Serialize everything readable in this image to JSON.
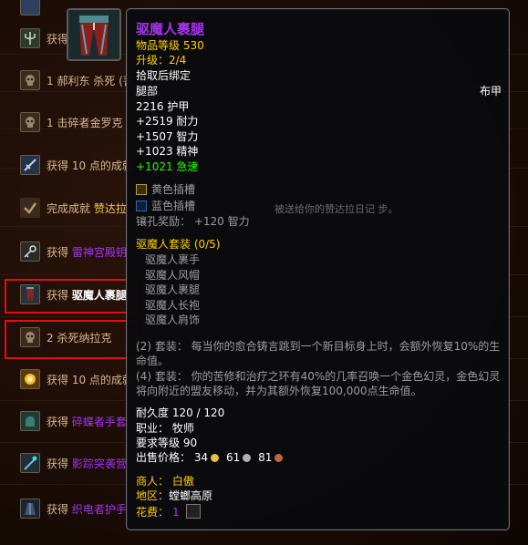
{
  "rows": [
    {
      "icon": "trident-icon",
      "text": "获得 "
    },
    {
      "icon": "skull-icon",
      "text": "1 郝利东 杀死 (菩"
    },
    {
      "icon": "skull-icon",
      "text": "1 击碎者金罗克"
    },
    {
      "icon": "sword-icon",
      "text": "获得 10 点的成就"
    },
    {
      "icon": "check-icon",
      "pre": "完成成就 ",
      "post": "赞达拉"
    },
    {
      "icon": "key-icon",
      "pre": "获得 ",
      "post": "雷神宫殿钥"
    },
    {
      "icon": "legs-armor-icon",
      "pre": "获得 ",
      "post": "驱魔人裹腿"
    },
    {
      "icon": "skull-icon",
      "text": "2 杀死纳拉克"
    },
    {
      "icon": "gold-burst-icon",
      "text": "获得 10 点的成就"
    },
    {
      "icon": "gloves-icon",
      "pre": "获得 ",
      "post": "碎蝶者手套"
    },
    {
      "icon": "staff-icon",
      "pre": "获得 ",
      "post": "影踪突袭营"
    },
    {
      "icon": "robe-icon",
      "pre": "获得 ",
      "post": "织电者护手"
    }
  ],
  "obscured_text": "被送给你的赞达拉日记 步。",
  "tooltip": {
    "name": "驱魔人裹腿",
    "item_level": "物品等级 530",
    "upgrade": "升级：2/4",
    "bind": "拾取后绑定",
    "slot": "腿部",
    "armor_type": "布甲",
    "armor": "2216 护甲",
    "stamina": "+2519 耐力",
    "intellect": "+1507 智力",
    "spirit": "+1023 精神",
    "haste": "+1021 急速",
    "socket_yellow": "黄色插槽",
    "socket_blue": "蓝色插槽",
    "socket_bonus": "镶孔奖励： +120 智力",
    "set_name": "驱魔人套装 (0/5)",
    "set_items": [
      "驱魔人裹手",
      "驱魔人风帽",
      "驱魔人裹腿",
      "驱魔人长袍",
      "驱魔人肩饰"
    ],
    "set_bonus_2_line1": "(2) 套装： 每当你的愈合铸言跳到一个新目标身上时，会额外恢复10%的生",
    "set_bonus_2_line2": "命值。",
    "set_bonus_4_line1": "(4) 套装： 你的苦修和治疗之环有40%的几率召唤一个金色幻灵，金色幻灵",
    "set_bonus_4_line2": "将向附近的盟友移动，并为其额外恢复100,000点生命值。",
    "durability": "耐久度 120 / 120",
    "class": "职业：  牧师",
    "req_level": "要求等级 90",
    "sell_label": "出售价格：",
    "sell_gold": "34",
    "sell_silver": "61",
    "sell_copper": "81",
    "merchant": "商人：  白傲",
    "zone_label": "地区：",
    "zone_value": "螳螂高原",
    "cost_label": "花费：",
    "cost_value": "1"
  },
  "colors": {
    "epic": "#a335ee",
    "gold_text": "#ffd100",
    "bonus_green": "#1eff00",
    "highlight_red": "#e01010"
  }
}
